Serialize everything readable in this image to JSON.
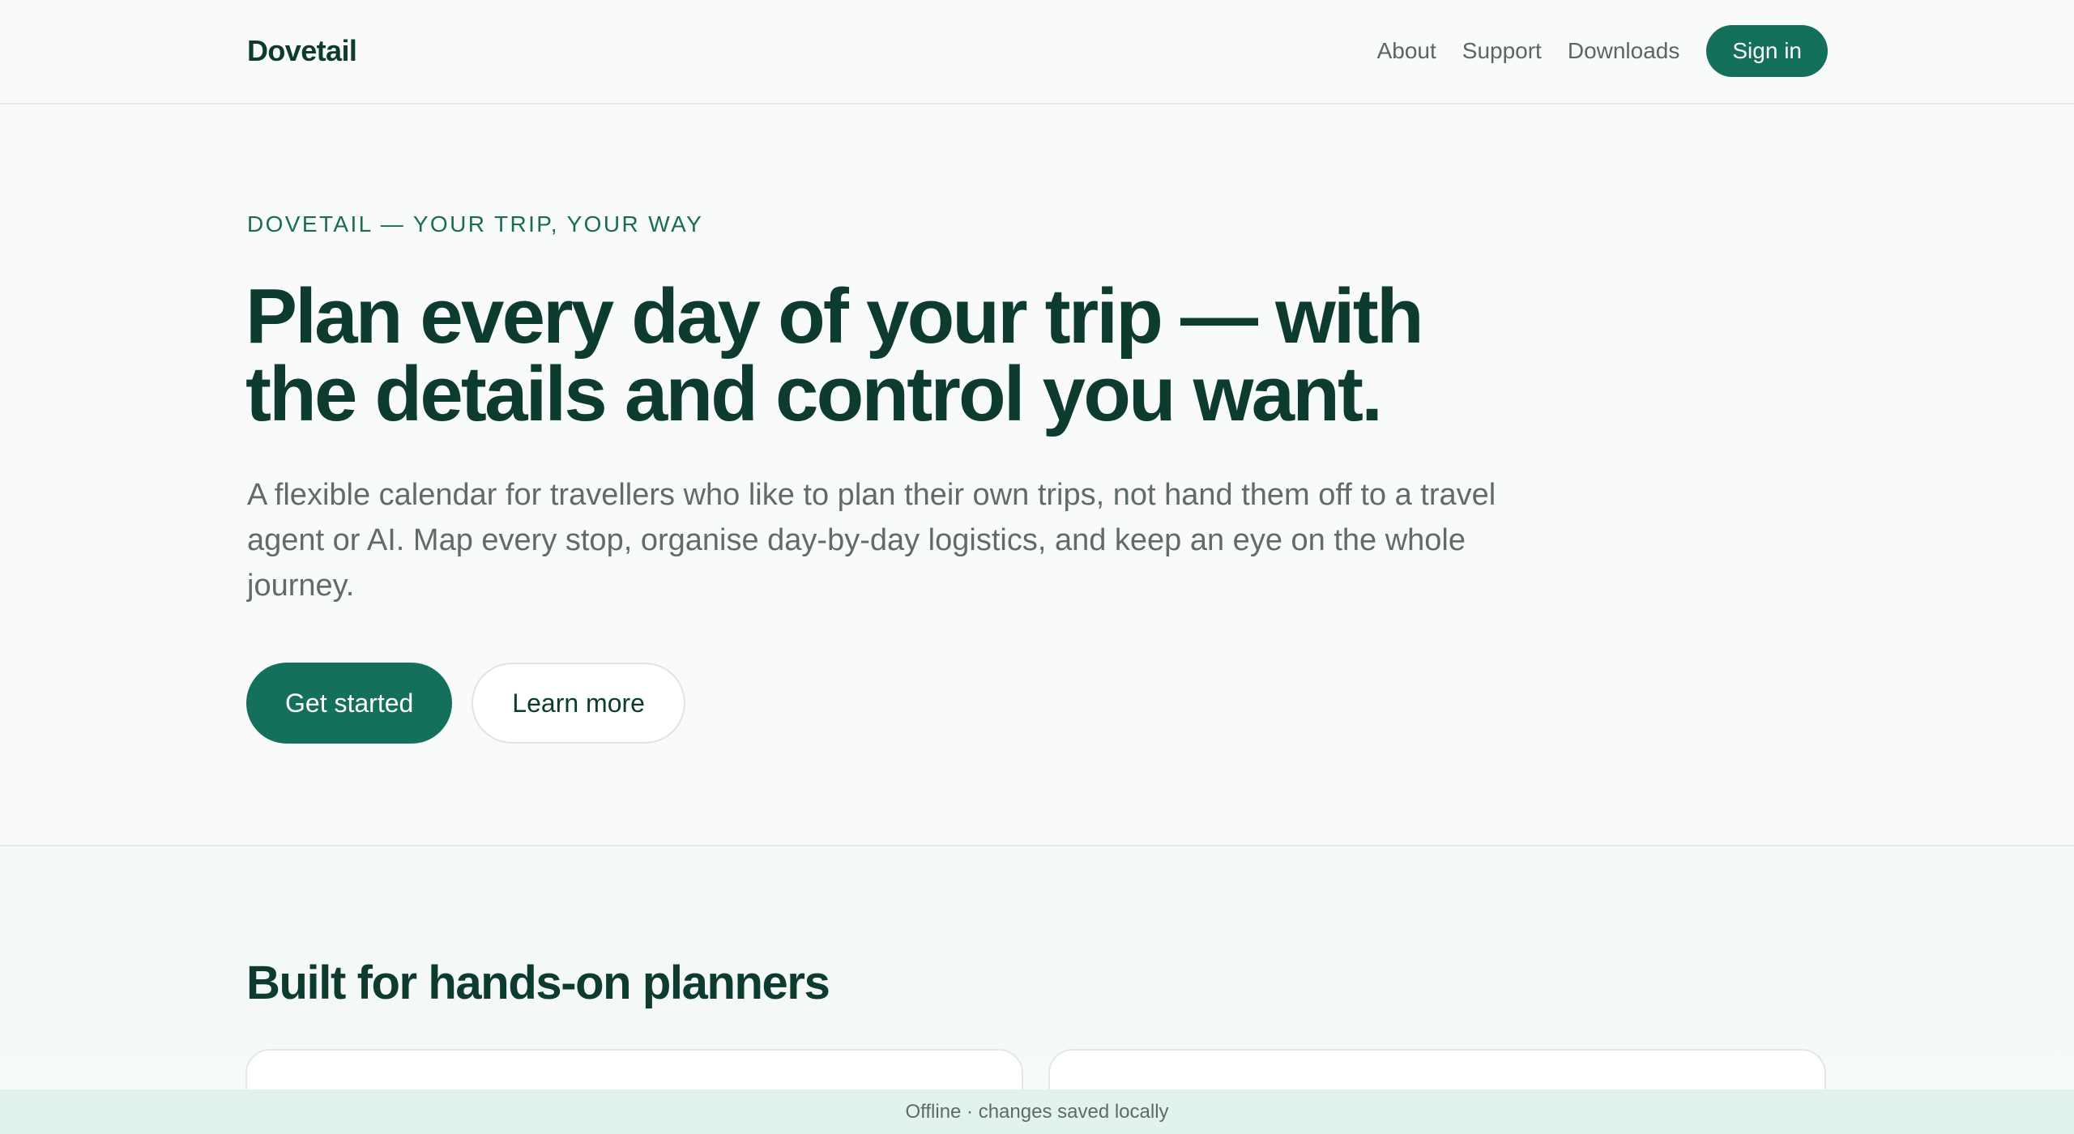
{
  "header": {
    "brand": "Dovetail",
    "nav": [
      "About",
      "Support",
      "Downloads"
    ],
    "signin_label": "Sign in"
  },
  "hero": {
    "eyebrow": "DOVETAIL — YOUR TRIP, YOUR WAY",
    "headline": "Plan every day of your trip — with the details and control you want.",
    "subtext": "A flexible calendar for travellers who like to plan their own trips, not hand them off to a travel agent or AI. Map every stop, organise day-by-day logistics, and keep an eye on the whole journey.",
    "primary_cta": "Get started",
    "secondary_cta": "Learn more"
  },
  "features": {
    "title": "Built for hands-on planners"
  },
  "status": {
    "text": "Offline · changes saved locally"
  },
  "colors": {
    "brand": "#14705a",
    "heading": "#0d3b30",
    "status_bg": "#e2f3ec"
  }
}
